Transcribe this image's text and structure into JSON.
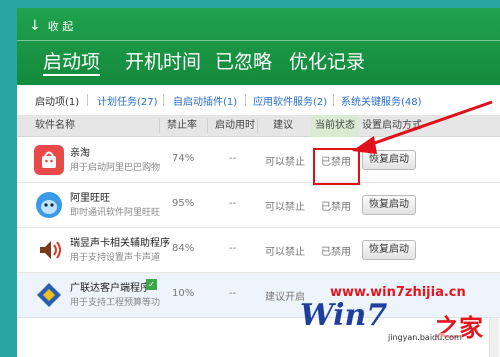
{
  "header": {
    "collapse_label": "收 起",
    "tabs": [
      {
        "label": "启动项",
        "active": true
      },
      {
        "label": "开机时间"
      },
      {
        "label": "已忽略"
      },
      {
        "label": "优化记录"
      }
    ]
  },
  "subtabs": [
    {
      "label": "启动项(1)",
      "active": true
    },
    {
      "label": "计划任务(27)"
    },
    {
      "label": "自启动插件(1)"
    },
    {
      "label": "应用软件服务(2)"
    },
    {
      "label": "系统关键服务(48)"
    }
  ],
  "table": {
    "columns": [
      "软件名称",
      "禁止率",
      "启动用时",
      "建议",
      "当前状态",
      "设置启动方式"
    ],
    "rows": [
      {
        "name": "亲淘",
        "desc": "用于启动阿里巴巴购物",
        "rate": "74%",
        "time": "--",
        "advice": "可以禁止",
        "status": "已禁用",
        "action": "恢复启动"
      },
      {
        "name": "阿里旺旺",
        "desc": "即时通讯软件阿里旺旺",
        "rate": "95%",
        "time": "--",
        "advice": "可以禁止",
        "status": "已禁用",
        "action": "恢复启动"
      },
      {
        "name": "瑞昱声卡相关辅助程序",
        "desc": "用于支持设置声卡声道",
        "rate": "84%",
        "time": "--",
        "advice": "可以禁止",
        "status": "已禁用",
        "action": "恢复启动"
      },
      {
        "name": "广联达客户端程序",
        "desc": "用于支持工程预算等功",
        "rate": "10%",
        "time": "--",
        "advice": "建议开启",
        "status": "",
        "action": ""
      }
    ]
  },
  "watermark": {
    "url": "www.win7zhijia.cn",
    "logo": "Win7",
    "logo_suffix": "之家",
    "sub": "jingyan.baidu.com"
  },
  "colors": {
    "header_green": "#1a9a46",
    "background_teal": "#2aa6a2",
    "annotation_red": "#e0101b",
    "link_blue": "#2a70c9"
  }
}
